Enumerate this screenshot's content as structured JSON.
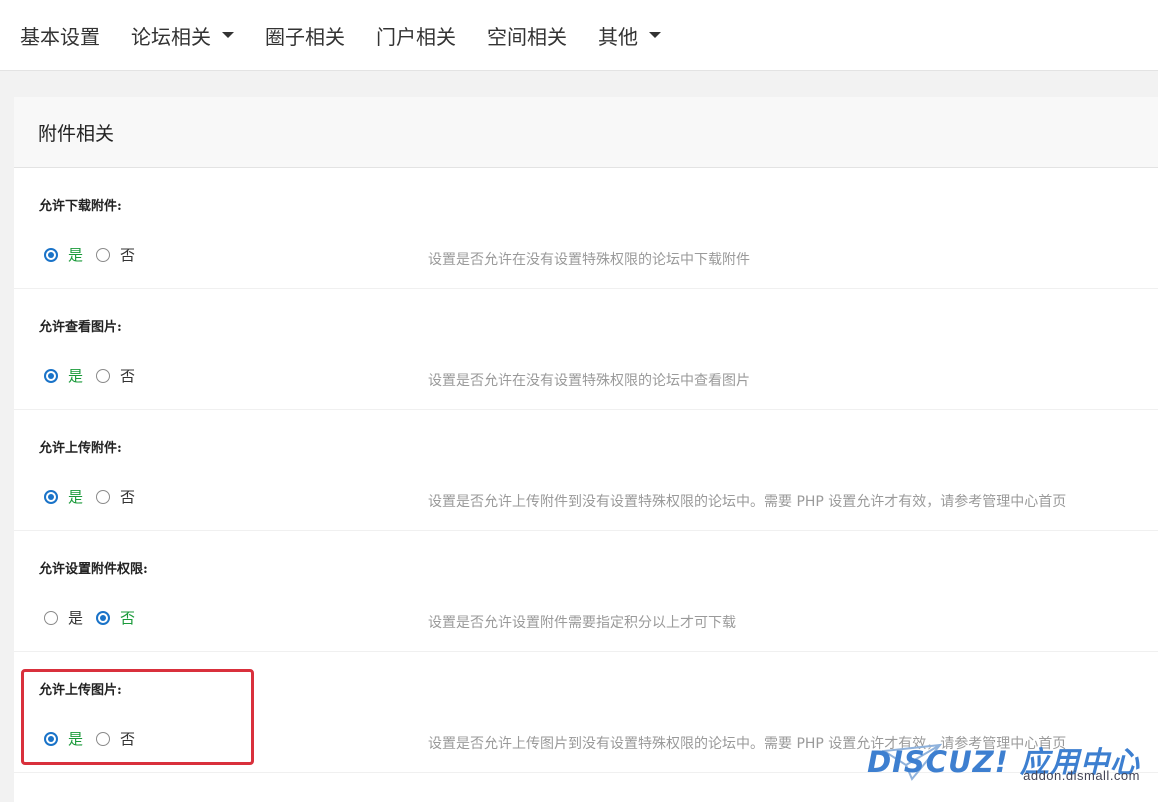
{
  "nav": {
    "items": [
      {
        "label": "基本设置",
        "dropdown": false
      },
      {
        "label": "论坛相关",
        "dropdown": true
      },
      {
        "label": "圈子相关",
        "dropdown": false
      },
      {
        "label": "门户相关",
        "dropdown": false
      },
      {
        "label": "空间相关",
        "dropdown": false
      },
      {
        "label": "其他",
        "dropdown": true
      }
    ]
  },
  "panel": {
    "title": "附件相关",
    "settings": [
      {
        "label": "允许下载附件:",
        "yes_label": "是",
        "no_label": "否",
        "selected": "yes",
        "description": "设置是否允许在没有设置特殊权限的论坛中下载附件"
      },
      {
        "label": "允许查看图片:",
        "yes_label": "是",
        "no_label": "否",
        "selected": "yes",
        "description": "设置是否允许在没有设置特殊权限的论坛中查看图片"
      },
      {
        "label": "允许上传附件:",
        "yes_label": "是",
        "no_label": "否",
        "selected": "yes",
        "description": "设置是否允许上传附件到没有设置特殊权限的论坛中。需要 PHP 设置允许才有效，请参考管理中心首页"
      },
      {
        "label": "允许设置附件权限:",
        "yes_label": "是",
        "no_label": "否",
        "selected": "no",
        "description": "设置是否允许设置附件需要指定积分以上才可下载"
      },
      {
        "label": "允许上传图片:",
        "yes_label": "是",
        "no_label": "否",
        "selected": "yes",
        "description": "设置是否允许上传图片到没有设置特殊权限的论坛中。需要 PHP 设置允许才有效，请参考管理中心首页"
      }
    ]
  },
  "watermark": {
    "brand": "DISCUZ! 应用中心",
    "site": "addon.dismall.com"
  },
  "colors": {
    "radio_checked": "#1a73c8",
    "selected_text": "#1a9a3a",
    "highlight_border": "#d9303c",
    "watermark_blue": "#3d7fd0"
  }
}
